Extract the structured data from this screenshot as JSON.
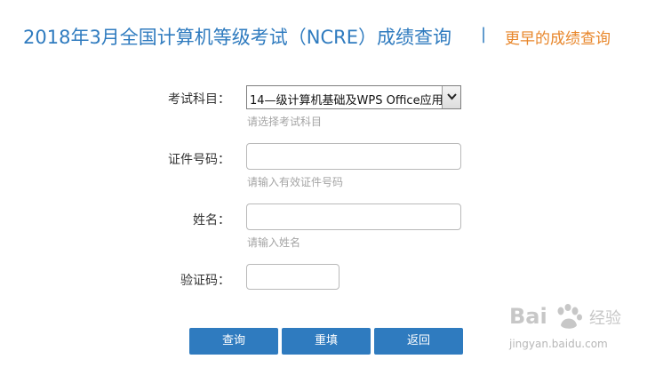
{
  "header": {
    "title": "2018年3月全国计算机等级考试（NCRE）成绩查询",
    "separator": "|",
    "earlier_link": "更早的成绩查询"
  },
  "form": {
    "subject": {
      "label": "考试科目：",
      "selected": "14—级计算机基础及WPS Office应用",
      "hint": "请选择考试科目"
    },
    "id_number": {
      "label": "证件号码：",
      "value": "",
      "hint": "请输入有效证件号码"
    },
    "name": {
      "label": "姓名：",
      "value": "",
      "hint": "请输入姓名"
    },
    "captcha": {
      "label": "验证码：",
      "value": ""
    }
  },
  "buttons": {
    "query": "查询",
    "reset": "重填",
    "back": "返回"
  },
  "watermark": {
    "brand": "Bai",
    "brand2": "经验",
    "url": "jingyan.baidu.com"
  },
  "colors": {
    "primary_blue": "#2f7bbf",
    "accent_orange": "#e8862a",
    "hint_gray": "#a5a5a5"
  }
}
